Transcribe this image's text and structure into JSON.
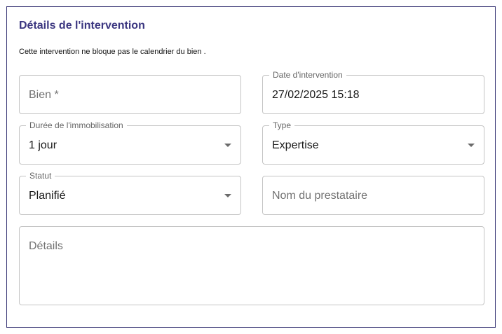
{
  "section": {
    "title": "Détails de l'intervention",
    "subtitle": "Cette intervention ne bloque pas le calendrier du bien ."
  },
  "fields": {
    "bien": {
      "placeholder": "Bien *"
    },
    "date": {
      "label": "Date d'intervention",
      "value": "27/02/2025 15:18"
    },
    "duree": {
      "label": "Durée de l'immobilisation",
      "value": "1 jour"
    },
    "type": {
      "label": "Type",
      "value": "Expertise"
    },
    "statut": {
      "label": "Statut",
      "value": "Planifié"
    },
    "prestataire": {
      "placeholder": "Nom du prestataire"
    },
    "details": {
      "placeholder": "Détails"
    }
  },
  "icons": {
    "select_caret": "caret-down-icon"
  },
  "colors": {
    "accent": "#3b3680",
    "border": "#c4c4c4",
    "panel_border": "#3d3a78"
  }
}
